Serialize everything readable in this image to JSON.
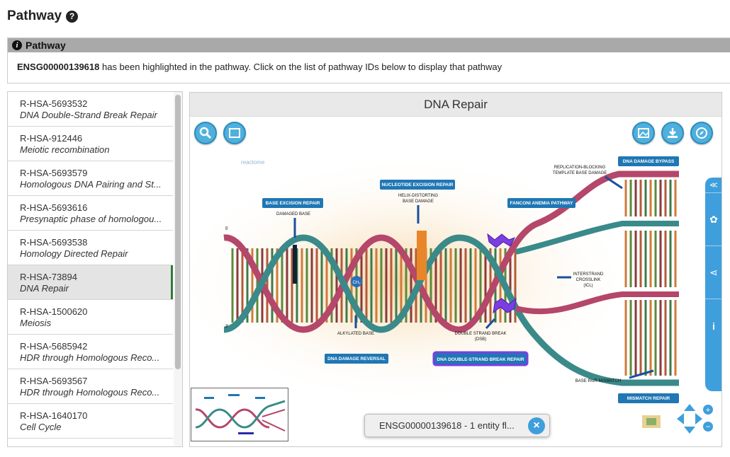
{
  "header": {
    "title": "Pathway",
    "help_icon": "question-circle-icon"
  },
  "info_panel": {
    "title": "Pathway",
    "icon": "info-circle-icon",
    "gene_id": "ENSG00000139618",
    "message": " has been highlighted in the pathway. Click on the list of pathway IDs below to display that pathway"
  },
  "pathway_list": [
    {
      "id": "R-HSA-5693532",
      "name": "DNA Double-Strand Break Repair"
    },
    {
      "id": "R-HSA-912446",
      "name": "Meiotic recombination"
    },
    {
      "id": "R-HSA-5693579",
      "name": "Homologous DNA Pairing and St..."
    },
    {
      "id": "R-HSA-5693616",
      "name": "Presynaptic phase of homologou..."
    },
    {
      "id": "R-HSA-5693538",
      "name": "Homology Directed Repair"
    },
    {
      "id": "R-HSA-73894",
      "name": "DNA Repair",
      "active": true
    },
    {
      "id": "R-HSA-1500620",
      "name": "Meiosis"
    },
    {
      "id": "R-HSA-5685942",
      "name": "HDR through Homologous Reco..."
    },
    {
      "id": "R-HSA-5693567",
      "name": "HDR through Homologous Reco..."
    },
    {
      "id": "R-HSA-1640170",
      "name": "Cell Cycle"
    }
  ],
  "viewer": {
    "title": "DNA Repair",
    "logo_text": "reactome",
    "flag_text": "ENSG00000139618 - 1 entity fl...",
    "buttons": [
      "search-icon",
      "fit-screen-icon",
      "image-export-icon",
      "download-icon",
      "compass-icon"
    ],
    "side_tabs": [
      "collapse-icon",
      "palette-icon",
      "share-icon",
      "info-icon"
    ],
    "diagram": {
      "labels": {
        "ber": "BASE EXCISION REPAIR",
        "ner": "NUCLEOTIDE EXCISION REPAIR",
        "fa": "FANCONI ANEMIA PATHWAY",
        "bypass": "DNA DAMAGE BYPASS",
        "reversal": "DNA DAMAGE REVERSAL",
        "dsb_repair": "DNA DOUBLE-STRAND BREAK REPAIR",
        "mismatch": "MISMATCH REPAIR"
      },
      "annotations": {
        "damaged_base": "DAMAGED BASE",
        "helix1": "HELIX-DISTORTING",
        "helix2": "BASE DAMAGE",
        "replication1": "REPLICATION-BLOCKING",
        "replication2": "TEMPLATE BASE DAMAGE",
        "icl1": "INTERSTRAND",
        "icl2": "CROSSLINK",
        "icl3": "(ICL)",
        "alkylated": "ALKYLATED BASE",
        "dsb1": "DOUBLE STRAND BREAK",
        "dsb2": "(DSB)",
        "mismatch_base": "BASE PAIR MISMATCH",
        "ch3": "CH₃"
      },
      "strand_ends": {
        "five": "5'",
        "three": "3'"
      }
    }
  },
  "colors": {
    "accent": "#3f9fdc",
    "active_bar": "#2e7d32",
    "strand_a": "#b4476a",
    "strand_b": "#3a8a8a"
  }
}
